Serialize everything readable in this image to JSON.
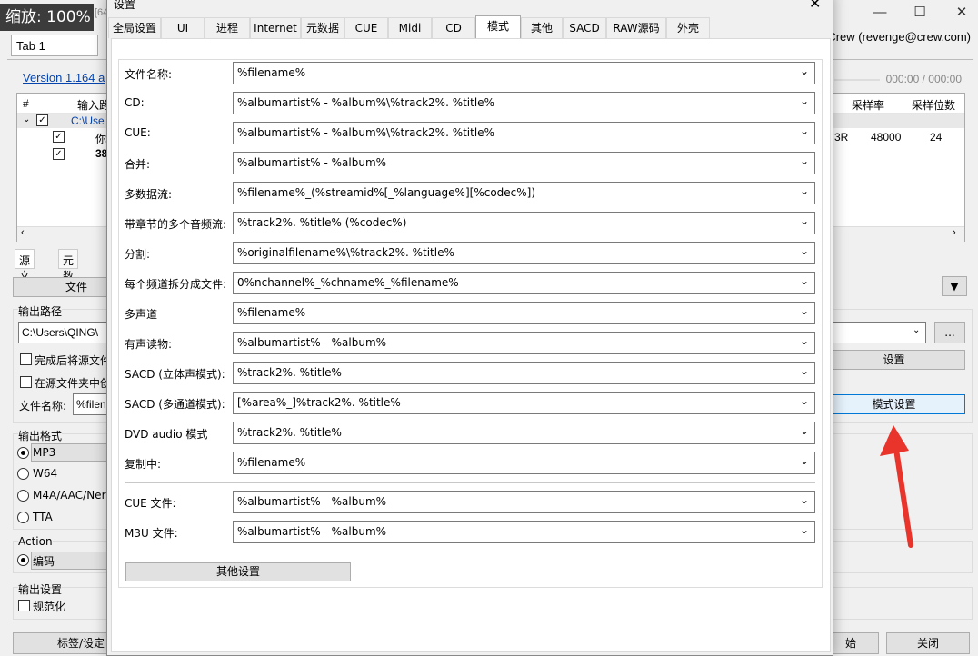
{
  "zoom": "缩放: 100%",
  "main_title_fragment": "[64",
  "main_tab": "Tab 1",
  "version_link": "Version 1.164 a",
  "author": "Crew (revenge@crew.com)",
  "window_controls": {
    "minimize": "—",
    "maximize": "☐",
    "close": "✕"
  },
  "time_display": "000:00 / 000:00",
  "tracklist": {
    "col_num": "#",
    "col_input": "输入路",
    "col_samplerate": "采样率",
    "col_bitdepth": "采样位数",
    "group_path": "C:\\Use",
    "row1_title": "你",
    "row2_title": "38",
    "row1_fragment": "3R",
    "row1_samplerate": "48000",
    "row1_bitdepth": "24"
  },
  "source_tabs": [
    "源文件",
    "元数据"
  ],
  "file_button": "文件",
  "output_path_label": "输出路径",
  "output_path_value": "C:\\Users\\QING\\",
  "delete_source_label": "完成后将源文件",
  "in_source_folder_label": "在源文件夹中创",
  "filename_label": "文件名称:",
  "filename_value": "%filen",
  "browse_button": "...",
  "settings_button": "设置",
  "mode_settings_button": "模式设置",
  "output_format_label": "输出格式",
  "formats": [
    "MP3",
    "W64",
    "M4A/AAC/Ner",
    "TTA"
  ],
  "action_label": "Action",
  "action_value": "编码",
  "output_settings_label": "输出设置",
  "normalize_label": "规范化",
  "tags_button": "标签/设定",
  "start_button_fragment": "始",
  "close_button": "关闭",
  "dialog": {
    "title": "设置",
    "close": "✕",
    "tabs": [
      "全局设置",
      "UI",
      "进程",
      "Internet",
      "元数据",
      "CUE",
      "Midi",
      "CD",
      "模式",
      "其他",
      "SACD",
      "RAW源码",
      "外壳"
    ],
    "active_tab": "模式",
    "rows": [
      {
        "label": "文件名称:",
        "value": "%filename%"
      },
      {
        "label": "CD:",
        "value": "%albumartist% - %album%\\%track2%. %title%"
      },
      {
        "label": "CUE:",
        "value": "%albumartist% - %album%\\%track2%. %title%"
      },
      {
        "label": "合并:",
        "value": "%albumartist% - %album%"
      },
      {
        "label": "多数据流:",
        "value": "%filename%_(%streamid%[_%language%][%codec%])"
      },
      {
        "label": "带章节的多个音频流:",
        "value": "%track2%. %title% (%codec%)"
      },
      {
        "label": "分割:",
        "value": "%originalfilename%\\%track2%. %title%"
      },
      {
        "label": "每个频道拆分成文件:",
        "value": "0%nchannel%_%chname%_%filename%"
      },
      {
        "label": "多声道",
        "value": "%filename%"
      },
      {
        "label": "有声读物:",
        "value": "%albumartist% - %album%"
      },
      {
        "label": "SACD (立体声模式):",
        "value": "%track2%. %title%"
      },
      {
        "label": "SACD (多通道模式):",
        "value": "[%area%_]%track2%. %title%"
      },
      {
        "label": "DVD audio 模式",
        "value": "%track2%. %title%"
      },
      {
        "label": "复制中:",
        "value": "%filename%"
      }
    ],
    "rows2": [
      {
        "label": "CUE 文件:",
        "value": "%albumartist% - %album%"
      },
      {
        "label": "M3U 文件:",
        "value": "%albumartist% - %album%"
      }
    ],
    "other_settings_button": "其他设置"
  },
  "colors": {
    "annotation_arrow": "#e8342a",
    "link": "#0645ad",
    "zoom_badge_bg": "#3c3c3c"
  }
}
